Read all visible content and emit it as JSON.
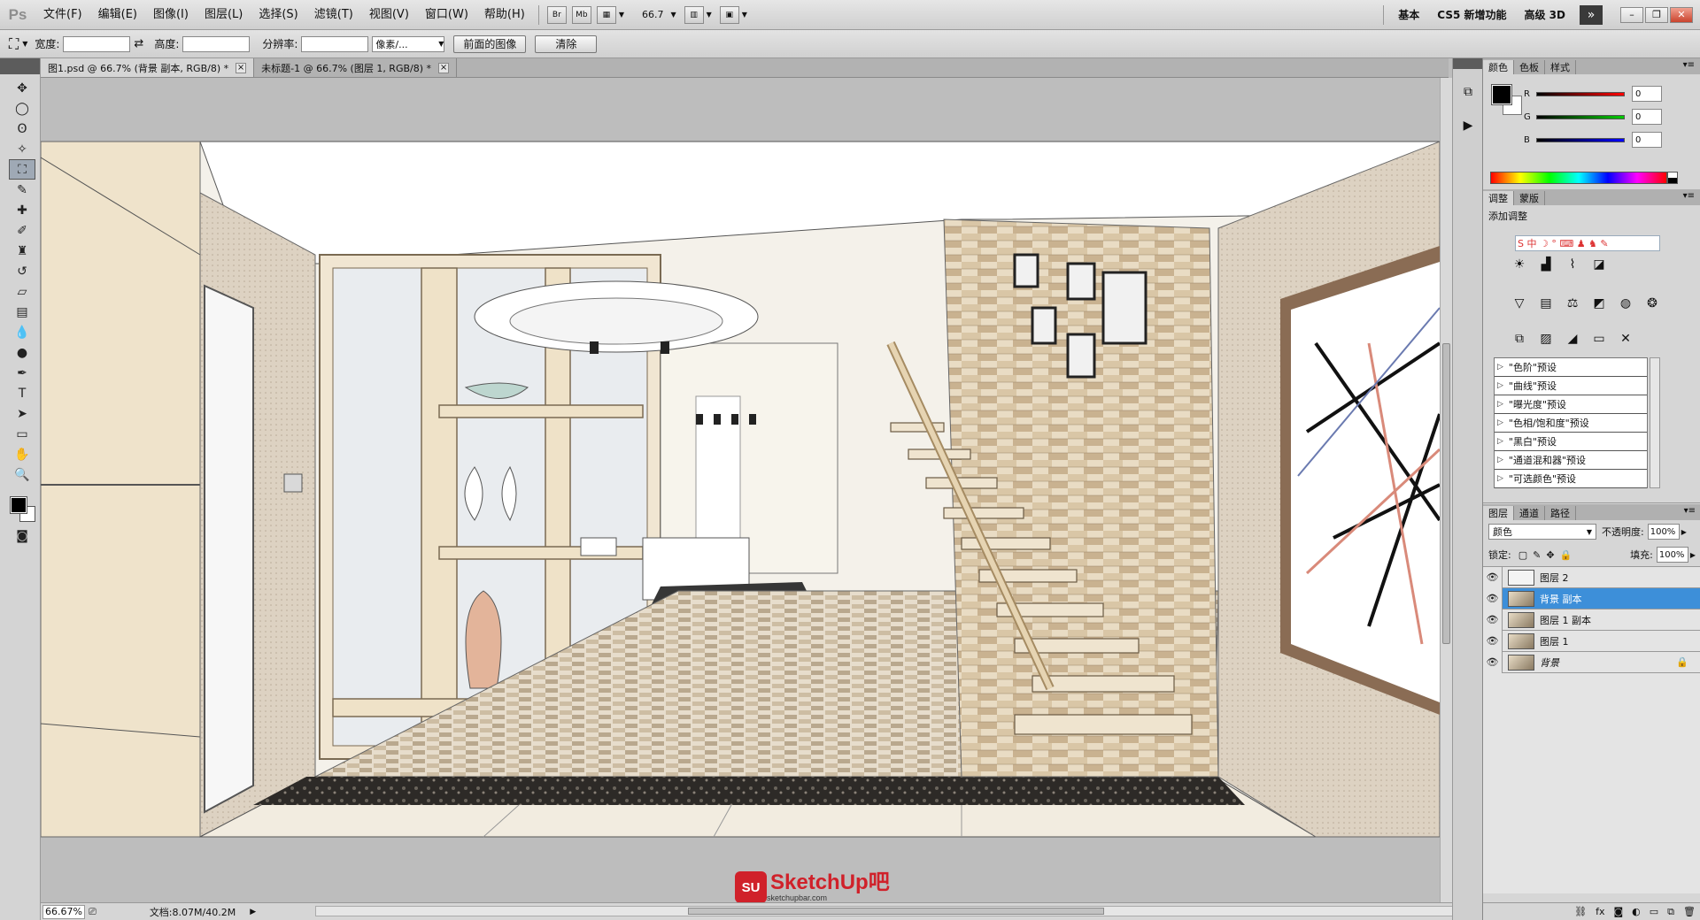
{
  "app": {
    "logo": "Ps",
    "menus": [
      "文件(F)",
      "编辑(E)",
      "图像(I)",
      "图层(L)",
      "选择(S)",
      "滤镜(T)",
      "视图(V)",
      "窗口(W)",
      "帮助(H)"
    ],
    "bridge_label": "Br",
    "minibridge_label": "Mb",
    "zoom_level": "66.7",
    "workspaces": [
      "基本",
      "CS5 新增功能",
      "高级 3D"
    ],
    "more_label": "»"
  },
  "options": {
    "width_label": "宽度:",
    "height_label": "高度:",
    "resolution_label": "分辨率:",
    "unit_value": "像素/...",
    "front_image_button": "前面的图像",
    "clear_button": "清除"
  },
  "document_tabs": [
    {
      "label": "图1.psd @ 66.7% (背景 副本, RGB/8) *",
      "active": true
    },
    {
      "label": "未标题-1 @ 66.7% (图层 1, RGB/8) *",
      "active": false
    }
  ],
  "status": {
    "zoom": "66.67%",
    "doc_info": "文档:8.07M/40.2M"
  },
  "color_panel": {
    "tabs": [
      "颜色",
      "色板",
      "样式"
    ],
    "channels": [
      {
        "label": "R",
        "value": "0",
        "color": "#d32020"
      },
      {
        "label": "G",
        "value": "0",
        "color": "#1ca11c"
      },
      {
        "label": "B",
        "value": "0",
        "color": "#1f2fd6"
      }
    ]
  },
  "adjustments_panel": {
    "tabs": [
      "调整",
      "蒙版"
    ],
    "title": "添加调整",
    "ime_text": "S 中 ☽ ° ⌨ ♟ ♞ ✎",
    "presets": [
      "\"色阶\"预设",
      "\"曲线\"预设",
      "\"曝光度\"预设",
      "\"色相/饱和度\"预设",
      "\"黑白\"预设",
      "\"通道混和器\"预设",
      "\"可选颜色\"预设"
    ]
  },
  "layers_panel": {
    "tabs": [
      "图层",
      "通道",
      "路径"
    ],
    "blend_mode": "颜色",
    "opacity_label": "不透明度:",
    "opacity_value": "100%",
    "lock_label": "锁定:",
    "fill_label": "填充:",
    "fill_value": "100%",
    "layers": [
      {
        "name": "图层 2",
        "selected": false,
        "thumb": "white",
        "locked": false
      },
      {
        "name": "背景 副本",
        "selected": true,
        "thumb": "image",
        "locked": false
      },
      {
        "name": "图层 1 副本",
        "selected": false,
        "thumb": "image",
        "locked": false
      },
      {
        "name": "图层 1",
        "selected": false,
        "thumb": "image",
        "locked": false
      },
      {
        "name": "背景",
        "selected": false,
        "thumb": "image",
        "locked": true
      }
    ]
  },
  "watermark": {
    "logo": "SU",
    "brand": "SketchUp吧",
    "url": "sketchupbar.com"
  },
  "tools": [
    "move-tool-icon",
    "marquee-tool-icon",
    "lasso-tool-icon",
    "quick-select-tool-icon",
    "crop-tool-icon",
    "eyedropper-tool-icon",
    "healing-brush-icon",
    "brush-tool-icon",
    "clone-stamp-icon",
    "history-brush-icon",
    "eraser-tool-icon",
    "gradient-tool-icon",
    "blur-tool-icon",
    "dodge-tool-icon",
    "pen-tool-icon",
    "type-tool-icon",
    "path-select-icon",
    "shape-tool-icon",
    "hand-tool-icon",
    "zoom-tool-icon"
  ]
}
